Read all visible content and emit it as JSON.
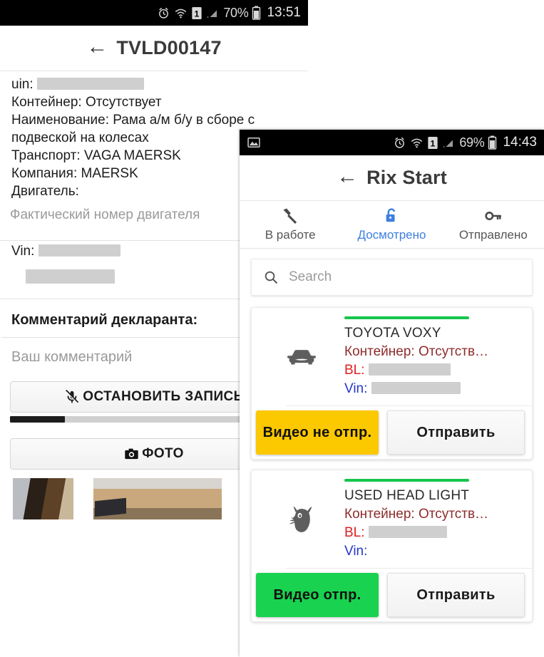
{
  "left_phone": {
    "statusbar": {
      "icons": [
        "alarm-icon",
        "wifi-icon",
        "sim1-icon",
        "signal-icon"
      ],
      "battery_pct": "70%",
      "time": "13:51"
    },
    "appbar": {
      "back": "←",
      "title": "TVLD00147"
    },
    "info": {
      "uin_label": "uin:",
      "container_line": "Контейнер: Отсутствует",
      "name_line": "Наименование: Рама а/м б/у в сборе с подвеской на колесах",
      "transport_line": "Транспорт: VAGA MAERSK",
      "company_line": "Компания: MAERSK",
      "engine_label": "Двигатель:"
    },
    "engine_field": {
      "placeholder": "Фактический номер двигателя",
      "value": ""
    },
    "vin": {
      "label": "Vin:",
      "value": ""
    },
    "comment": {
      "title": "Комментарий декларанта:",
      "placeholder": "Ваш комментарий",
      "value": ""
    },
    "record_button": {
      "label": "ОСТАНОВИТЬ ЗАПИСЬ",
      "icon": "mic-off-icon"
    },
    "record_progress_pct": 19,
    "photo_button": {
      "label": "ФОТО",
      "icon": "camera-icon"
    },
    "thumbnails": [
      "photo-thumb-1",
      "photo-thumb-2",
      "photo-thumb-3"
    ]
  },
  "right_phone": {
    "statusbar": {
      "left_icon": "image-notification-icon",
      "icons": [
        "alarm-icon",
        "wifi-icon",
        "sim1-icon",
        "signal-icon"
      ],
      "battery_pct": "69%",
      "time": "14:43"
    },
    "appbar": {
      "back": "←",
      "title": "Rix Start"
    },
    "tabs": [
      {
        "label": "В работе",
        "icon": "hammer-icon",
        "active": false
      },
      {
        "label": "Досмотрено",
        "icon": "lock-open-icon",
        "active": true
      },
      {
        "label": "Отправлено",
        "icon": "key-icon",
        "active": false
      }
    ],
    "search": {
      "placeholder": "Search",
      "value": "",
      "icon": "search-icon"
    },
    "cards": [
      {
        "icon": "car-icon",
        "title": "TOYOTA VOXY",
        "container_label": "Контейнер: ",
        "container_value": "Отсутств…",
        "bl_label": "BL:",
        "bl_value": "",
        "vin_label": "Vin:",
        "vin_value": "",
        "video_button": "Видео не отпр.",
        "video_state": "not-sent",
        "send_button": "Отправить"
      },
      {
        "icon": "gremlin-icon",
        "title": "USED HEAD LIGHT",
        "container_label": "Контейнер: ",
        "container_value": "Отсутств…",
        "bl_label": "BL:",
        "bl_value": "",
        "vin_label": "Vin:",
        "vin_value": "",
        "video_button": "Видео отпр.",
        "video_state": "sent",
        "send_button": "Отправить"
      }
    ]
  },
  "colors": {
    "accent_green": "#16c54c",
    "video_sent": "#19d24f",
    "video_not_sent": "#fcc800",
    "tab_active": "#3f7fe0",
    "label_bl": "#e02020",
    "label_vin": "#2337c8",
    "label_container": "#8e2b2b"
  }
}
